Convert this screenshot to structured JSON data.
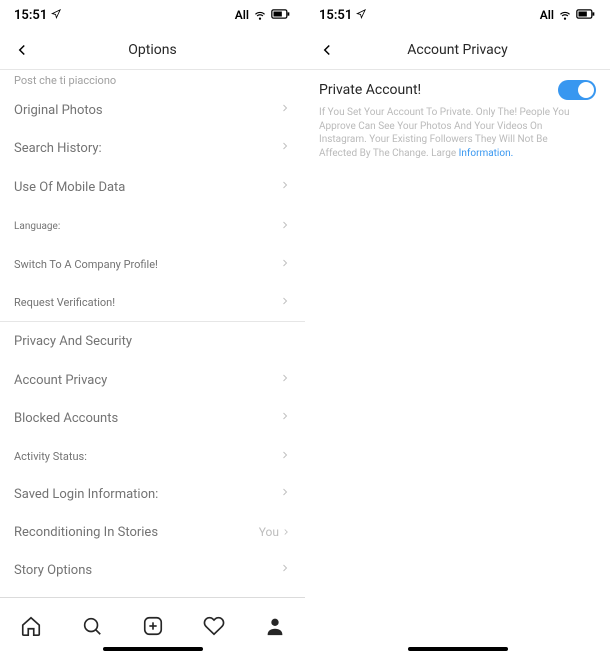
{
  "status": {
    "time": "15:51",
    "carrier": "All"
  },
  "screen1": {
    "title": "Options",
    "truncated_top": "Post che ti piacciono",
    "items": [
      {
        "label": "Original Photos"
      },
      {
        "label": "Search History:"
      },
      {
        "label": "Use Of Mobile Data"
      },
      {
        "label": "Language:"
      },
      {
        "label": "Switch To A Company Profile!"
      },
      {
        "label": "Request Verification!"
      }
    ],
    "section": "Privacy And Security",
    "section_items": [
      {
        "label": "Account Privacy"
      },
      {
        "label": "Blocked Accounts"
      },
      {
        "label": "Activity Status:"
      },
      {
        "label": "Saved Login Information:"
      },
      {
        "label": "Reconditioning In Stories",
        "right": "You"
      },
      {
        "label": "Story Options "
      }
    ]
  },
  "screen2": {
    "title": "Account Privacy",
    "private_label": "Private Account!",
    "desc": "If You Set Your Account To Private. Only The! People You Approve Can See Your Photos And Your Videos On Instagram. Your Existing Followers They Will Not Be Affected By The Change. Large ",
    "info": "Information."
  }
}
